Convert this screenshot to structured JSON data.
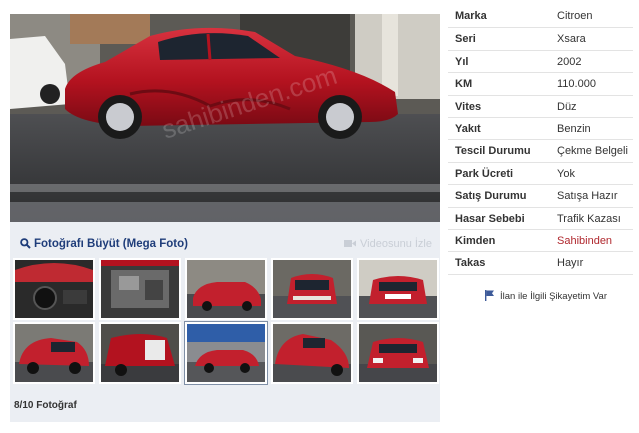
{
  "gallery": {
    "enlarge_label": "Fotoğrafı Büyüt (Mega Foto)",
    "video_label": "Videosunu İzle",
    "counter": "8/10 Fotoğraf",
    "selected_index": 8,
    "watermark": "sahibinden.com"
  },
  "info": {
    "rows": [
      {
        "key": "Marka",
        "value": "Citroen"
      },
      {
        "key": "Seri",
        "value": "Xsara"
      },
      {
        "key": "Yıl",
        "value": "2002"
      },
      {
        "key": "KM",
        "value": "110.000"
      },
      {
        "key": "Vites",
        "value": "Düz"
      },
      {
        "key": "Yakıt",
        "value": "Benzin"
      },
      {
        "key": "Tescil Durumu",
        "value": "Çekme Belgeli"
      },
      {
        "key": "Park Ücreti",
        "value": "Yok"
      },
      {
        "key": "Satış Durumu",
        "value": "Satışa Hazır"
      },
      {
        "key": "Hasar Sebebi",
        "value": "Trafik Kazası"
      },
      {
        "key": "Kimden",
        "value": "Sahibinden"
      },
      {
        "key": "Takas",
        "value": "Hayır"
      }
    ],
    "complaint_label": "İlan ile İlgili Şikayetim Var"
  },
  "colors": {
    "car_red": "#b3121f",
    "link_red": "#b0282e",
    "nav_blue": "#1f3d7a"
  },
  "icons": {
    "enlarge": "magnifier-icon",
    "video": "video-camera-icon",
    "complaint": "flag-icon"
  }
}
